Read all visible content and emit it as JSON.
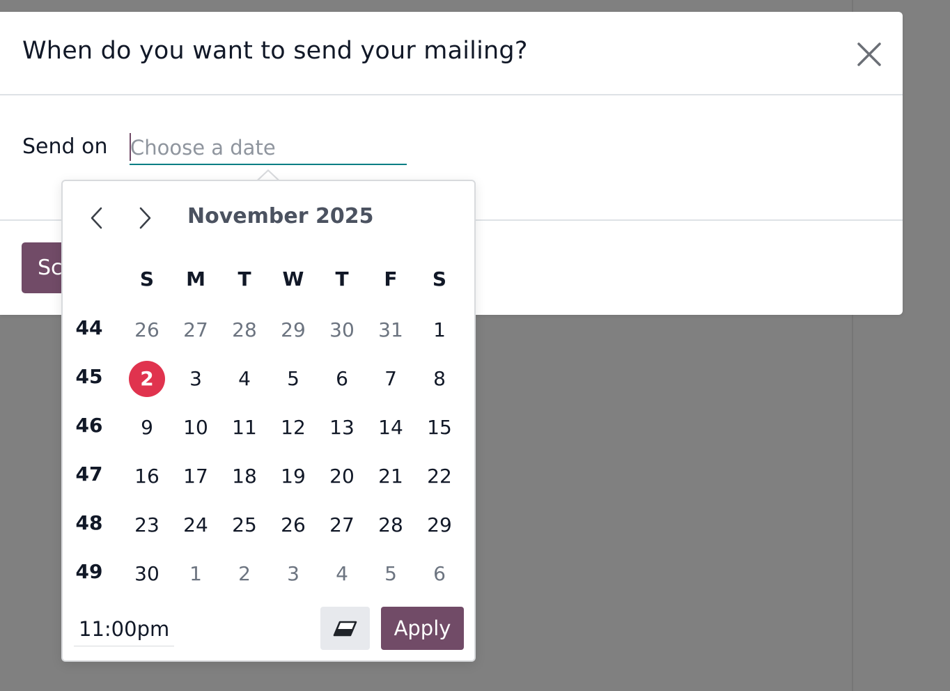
{
  "dialog": {
    "title": "When do you want to send your mailing?",
    "send_on_label": "Send on",
    "date_placeholder": "Choose a date",
    "date_value": "",
    "footer_button_label": "Sc"
  },
  "datepicker": {
    "month_title": "November 2025",
    "weekday_headers": [
      "S",
      "M",
      "T",
      "W",
      "T",
      "F",
      "S"
    ],
    "weeks": [
      {
        "number": "44",
        "days": [
          {
            "d": "26",
            "muted": true
          },
          {
            "d": "27",
            "muted": true
          },
          {
            "d": "28",
            "muted": true
          },
          {
            "d": "29",
            "muted": true
          },
          {
            "d": "30",
            "muted": true
          },
          {
            "d": "31",
            "muted": true
          },
          {
            "d": "1",
            "muted": false
          }
        ]
      },
      {
        "number": "45",
        "days": [
          {
            "d": "2",
            "muted": false,
            "today": true
          },
          {
            "d": "3",
            "muted": false
          },
          {
            "d": "4",
            "muted": false
          },
          {
            "d": "5",
            "muted": false
          },
          {
            "d": "6",
            "muted": false
          },
          {
            "d": "7",
            "muted": false
          },
          {
            "d": "8",
            "muted": false
          }
        ]
      },
      {
        "number": "46",
        "days": [
          {
            "d": "9",
            "muted": false
          },
          {
            "d": "10",
            "muted": false
          },
          {
            "d": "11",
            "muted": false
          },
          {
            "d": "12",
            "muted": false
          },
          {
            "d": "13",
            "muted": false
          },
          {
            "d": "14",
            "muted": false
          },
          {
            "d": "15",
            "muted": false
          }
        ]
      },
      {
        "number": "47",
        "days": [
          {
            "d": "16",
            "muted": false
          },
          {
            "d": "17",
            "muted": false
          },
          {
            "d": "18",
            "muted": false
          },
          {
            "d": "19",
            "muted": false
          },
          {
            "d": "20",
            "muted": false
          },
          {
            "d": "21",
            "muted": false
          },
          {
            "d": "22",
            "muted": false
          }
        ]
      },
      {
        "number": "48",
        "days": [
          {
            "d": "23",
            "muted": false
          },
          {
            "d": "24",
            "muted": false
          },
          {
            "d": "25",
            "muted": false
          },
          {
            "d": "26",
            "muted": false
          },
          {
            "d": "27",
            "muted": false
          },
          {
            "d": "28",
            "muted": false
          },
          {
            "d": "29",
            "muted": false
          }
        ]
      },
      {
        "number": "49",
        "days": [
          {
            "d": "30",
            "muted": false
          },
          {
            "d": "1",
            "muted": true
          },
          {
            "d": "2",
            "muted": true
          },
          {
            "d": "3",
            "muted": true
          },
          {
            "d": "4",
            "muted": true
          },
          {
            "d": "5",
            "muted": true
          },
          {
            "d": "6",
            "muted": true
          }
        ]
      }
    ],
    "time_value": "11:00pm",
    "apply_label": "Apply",
    "icons": {
      "prev": "chevron-left-icon",
      "next": "chevron-right-icon",
      "clear": "eraser-icon",
      "close": "close-icon"
    }
  },
  "colors": {
    "brand": "#714b67",
    "today": "#e0334e",
    "input_underline": "#017e84",
    "backdrop": "#808080"
  }
}
